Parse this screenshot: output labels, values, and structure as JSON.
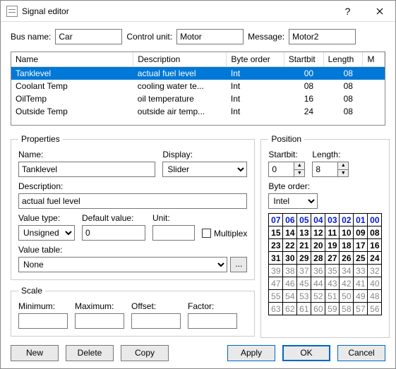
{
  "window": {
    "title": "Signal editor"
  },
  "top": {
    "bus_label": "Bus name:",
    "bus_value": "Car",
    "cu_label": "Control unit:",
    "cu_value": "Motor",
    "msg_label": "Message:",
    "msg_value": "Motor2"
  },
  "table": {
    "headers": {
      "name": "Name",
      "desc": "Description",
      "byteorder": "Byte order",
      "startbit": "Startbit",
      "length": "Length",
      "m": "M"
    },
    "rows": [
      {
        "name": "Tanklevel",
        "desc": "actual fuel level",
        "byteorder": "Int",
        "startbit": "00",
        "length": "08",
        "m": ""
      },
      {
        "name": "Coolant Temp",
        "desc": "cooling water te...",
        "byteorder": "Int",
        "startbit": "08",
        "length": "08",
        "m": ""
      },
      {
        "name": "OilTemp",
        "desc": "oil temperature",
        "byteorder": "Int",
        "startbit": "16",
        "length": "08",
        "m": ""
      },
      {
        "name": "Outside Temp",
        "desc": "outside air temp...",
        "byteorder": "Int",
        "startbit": "24",
        "length": "08",
        "m": ""
      }
    ],
    "selected_index": 0
  },
  "properties": {
    "legend": "Properties",
    "name_label": "Name:",
    "name_value": "Tanklevel",
    "display_label": "Display:",
    "display_value": "Slider",
    "desc_label": "Description:",
    "desc_value": "actual fuel level",
    "valuetype_label": "Value type:",
    "valuetype_value": "Unsigned",
    "default_label": "Default value:",
    "default_value": "0",
    "unit_label": "Unit:",
    "unit_value": "",
    "multiplex_label": "Multiplex",
    "valuetable_label": "Value table:",
    "valuetable_value": "None"
  },
  "scale": {
    "legend": "Scale",
    "min_label": "Minimum:",
    "min_value": "",
    "max_label": "Maximum:",
    "max_value": "",
    "offset_label": "Offset:",
    "offset_value": "",
    "factor_label": "Factor:",
    "factor_value": ""
  },
  "position": {
    "legend": "Position",
    "startbit_label": "Startbit:",
    "startbit_value": "0",
    "length_label": "Length:",
    "length_value": "8",
    "byteorder_label": "Byte order:",
    "byteorder_value": "Intel",
    "selected_bits": [
      0,
      1,
      2,
      3,
      4,
      5,
      6,
      7
    ],
    "active_row_max": 3
  },
  "buttons": {
    "new": "New",
    "delete": "Delete",
    "copy": "Copy",
    "apply": "Apply",
    "ok": "OK",
    "cancel": "Cancel"
  }
}
